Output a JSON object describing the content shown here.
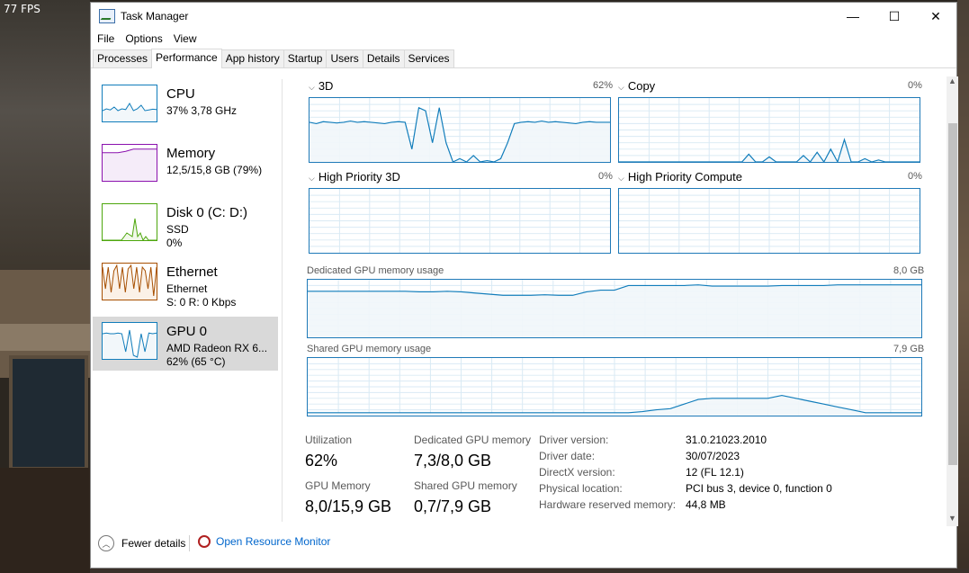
{
  "overlay": {
    "fps": "77 FPS"
  },
  "window": {
    "title": "Task Manager",
    "controls": {
      "minimize": "—",
      "maximize": "☐",
      "close": "✕"
    }
  },
  "menu": [
    "File",
    "Options",
    "View"
  ],
  "tabs": [
    "Processes",
    "Performance",
    "App history",
    "Startup",
    "Users",
    "Details",
    "Services"
  ],
  "active_tab": "Performance",
  "sidebar": [
    {
      "name": "CPU",
      "line1": "37% 3,78 GHz",
      "line2": "",
      "color": "#117dbb",
      "fill": "#f1f6fa"
    },
    {
      "name": "Memory",
      "line1": "12,5/15,8 GB (79%)",
      "line2": "",
      "color": "#8b12ae",
      "fill": "#f4eaf8"
    },
    {
      "name": "Disk 0 (C: D:)",
      "line1": "SSD",
      "line2": "0%",
      "color": "#4da60c",
      "fill": "#eff7e8"
    },
    {
      "name": "Ethernet",
      "line1": "Ethernet",
      "line2": "S: 0 R: 0 Kbps",
      "color": "#a74f01",
      "fill": "#fbefe4"
    },
    {
      "name": "GPU 0",
      "line1": "AMD Radeon RX 6...",
      "line2": "62% (65 °C)",
      "color": "#117dbb",
      "fill": "#f1f6fa"
    }
  ],
  "engines": [
    {
      "label": "3D",
      "pct": "62%"
    },
    {
      "label": "Copy",
      "pct": "0%"
    },
    {
      "label": "High Priority 3D",
      "pct": "0%"
    },
    {
      "label": "High Priority Compute",
      "pct": "0%"
    }
  ],
  "memory_graphs": [
    {
      "label": "Dedicated GPU memory usage",
      "max": "8,0 GB"
    },
    {
      "label": "Shared GPU memory usage",
      "max": "7,9 GB"
    }
  ],
  "stats": [
    {
      "label": "Utilization",
      "value": "62%"
    },
    {
      "label": "Dedicated GPU memory",
      "value": "7,3/8,0 GB"
    },
    {
      "label": "GPU Memory",
      "value": "8,0/15,9 GB"
    },
    {
      "label": "Shared GPU memory",
      "value": "0,7/7,9 GB"
    }
  ],
  "details": [
    {
      "label": "Driver version:",
      "value": "31.0.21023.2010"
    },
    {
      "label": "Driver date:",
      "value": "30/07/2023"
    },
    {
      "label": "DirectX version:",
      "value": "12 (FL 12.1)"
    },
    {
      "label": "Physical location:",
      "value": "PCI bus 3, device 0, function 0"
    },
    {
      "label": "Hardware reserved memory:",
      "value": "44,8 MB"
    }
  ],
  "footer": {
    "fewer_details": "Fewer details",
    "open_resource_monitor": "Open Resource Monitor"
  },
  "colors": {
    "gpu_line": "#117dbb",
    "gpu_fill": "#f1f6fa",
    "grid": "#d9eaf4",
    "link": "#0066cc"
  },
  "graphs": {
    "engine_3d": [
      0.62,
      0.6,
      0.63,
      0.62,
      0.61,
      0.62,
      0.64,
      0.62,
      0.63,
      0.62,
      0.61,
      0.6,
      0.62,
      0.63,
      0.62,
      0.2,
      0.85,
      0.8,
      0.3,
      0.85,
      0.3,
      0.0,
      0.05,
      0.0,
      0.1,
      0.0,
      0.02,
      0.0,
      0.05,
      0.3,
      0.6,
      0.62,
      0.63,
      0.62,
      0.64,
      0.62,
      0.63,
      0.62,
      0.61,
      0.6,
      0.62,
      0.63,
      0.62,
      0.62,
      0.62
    ],
    "copy": [
      0,
      0,
      0,
      0,
      0,
      0,
      0,
      0,
      0,
      0,
      0,
      0,
      0,
      0,
      0,
      0,
      0,
      0,
      0,
      0.12,
      0,
      0,
      0.08,
      0,
      0,
      0,
      0,
      0.1,
      0,
      0.15,
      0,
      0.2,
      0,
      0.35,
      0,
      0,
      0.05,
      0,
      0.03,
      0,
      0,
      0,
      0,
      0,
      0
    ],
    "high_3d": [],
    "high_compute": [],
    "dedicated": [
      0.8,
      0.8,
      0.8,
      0.8,
      0.8,
      0.8,
      0.8,
      0.8,
      0.79,
      0.79,
      0.8,
      0.79,
      0.77,
      0.75,
      0.73,
      0.73,
      0.73,
      0.74,
      0.73,
      0.73,
      0.79,
      0.82,
      0.82,
      0.9,
      0.9,
      0.9,
      0.9,
      0.9,
      0.91,
      0.89,
      0.89,
      0.89,
      0.89,
      0.89,
      0.9,
      0.9,
      0.9,
      0.9,
      0.91,
      0.91,
      0.91,
      0.91,
      0.91,
      0.91,
      0.91
    ],
    "shared": [
      0.05,
      0.05,
      0.05,
      0.05,
      0.05,
      0.05,
      0.05,
      0.05,
      0.05,
      0.05,
      0.05,
      0.05,
      0.05,
      0.05,
      0.05,
      0.05,
      0.05,
      0.05,
      0.05,
      0.05,
      0.05,
      0.05,
      0.05,
      0.05,
      0.07,
      0.1,
      0.12,
      0.2,
      0.28,
      0.3,
      0.3,
      0.3,
      0.3,
      0.3,
      0.35,
      0.3,
      0.25,
      0.2,
      0.15,
      0.1,
      0.05,
      0.05,
      0.05,
      0.05,
      0.05
    ],
    "thumb_cpu": [
      0.3,
      0.35,
      0.32,
      0.4,
      0.3,
      0.35,
      0.33,
      0.5,
      0.3,
      0.35,
      0.45,
      0.3,
      0.32,
      0.34,
      0.33
    ],
    "thumb_mem": [
      0.78,
      0.78,
      0.78,
      0.78,
      0.78,
      0.8,
      0.82,
      0.85,
      0.88,
      0.88,
      0.88,
      0.88,
      0.88,
      0.88,
      0.88
    ],
    "thumb_disk": [
      0,
      0,
      0,
      0,
      0,
      0,
      0,
      0,
      0.1,
      0.2,
      0.15,
      0.1,
      0.6,
      0.1,
      0.2,
      0,
      0.1,
      0,
      0,
      0,
      0
    ],
    "thumb_eth": [
      0.9,
      0.3,
      0.9,
      0.2,
      0.8,
      0.95,
      0.3,
      0.9,
      0.2,
      0.85,
      0.95,
      0.3,
      0.9,
      0.2,
      0.9,
      0.8,
      0.3,
      0.9,
      0.1,
      0.9
    ],
    "thumb_gpu": [
      0.7,
      0.72,
      0.7,
      0.7,
      0.72,
      0.7,
      0.2,
      0.8,
      0.1,
      0.05,
      0.7,
      0.2,
      0.72,
      0.7,
      0.72
    ]
  }
}
